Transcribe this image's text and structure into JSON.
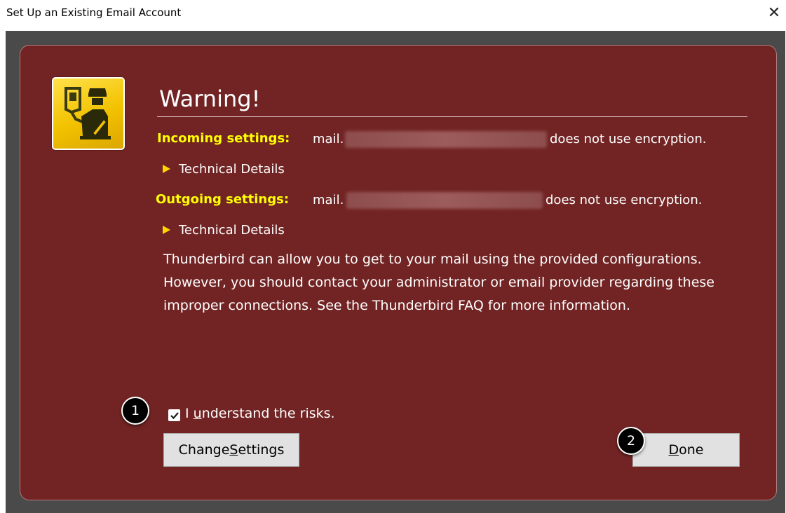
{
  "window": {
    "title": "Set Up an Existing Email Account",
    "close_glyph": "✕"
  },
  "warning": {
    "heading": "Warning!",
    "incoming": {
      "label": "Incoming settings:",
      "host_prefix": "mail.",
      "note": "does not use encryption.",
      "details_label": "Technical Details"
    },
    "outgoing": {
      "label": "Outgoing settings:",
      "host_prefix": "mail.",
      "note": "does not use encryption.",
      "details_label": "Technical Details"
    },
    "body": "Thunderbird can allow you to get to your mail using the provided configurations. However, you should contact your administrator or email provider regarding these improper connections. See the Thunderbird FAQ for more information."
  },
  "consent": {
    "checked": true,
    "label_prefix": "I ",
    "label_access": "u",
    "label_rest": "nderstand the risks."
  },
  "buttons": {
    "change_settings_prefix": "Change ",
    "change_settings_access": "S",
    "change_settings_rest": "ettings",
    "done_access": "D",
    "done_rest": "one"
  },
  "callouts": {
    "one": "1",
    "two": "2"
  },
  "colors": {
    "panel": "#722424",
    "label_yellow": "#ffff00",
    "icon_yellow": "#f2c200",
    "frame": "#4a4a4a"
  },
  "icons": {
    "app": "id-check-officer-icon",
    "close": "close-icon",
    "expand": "triangle-right-icon",
    "check": "checkmark-icon"
  }
}
